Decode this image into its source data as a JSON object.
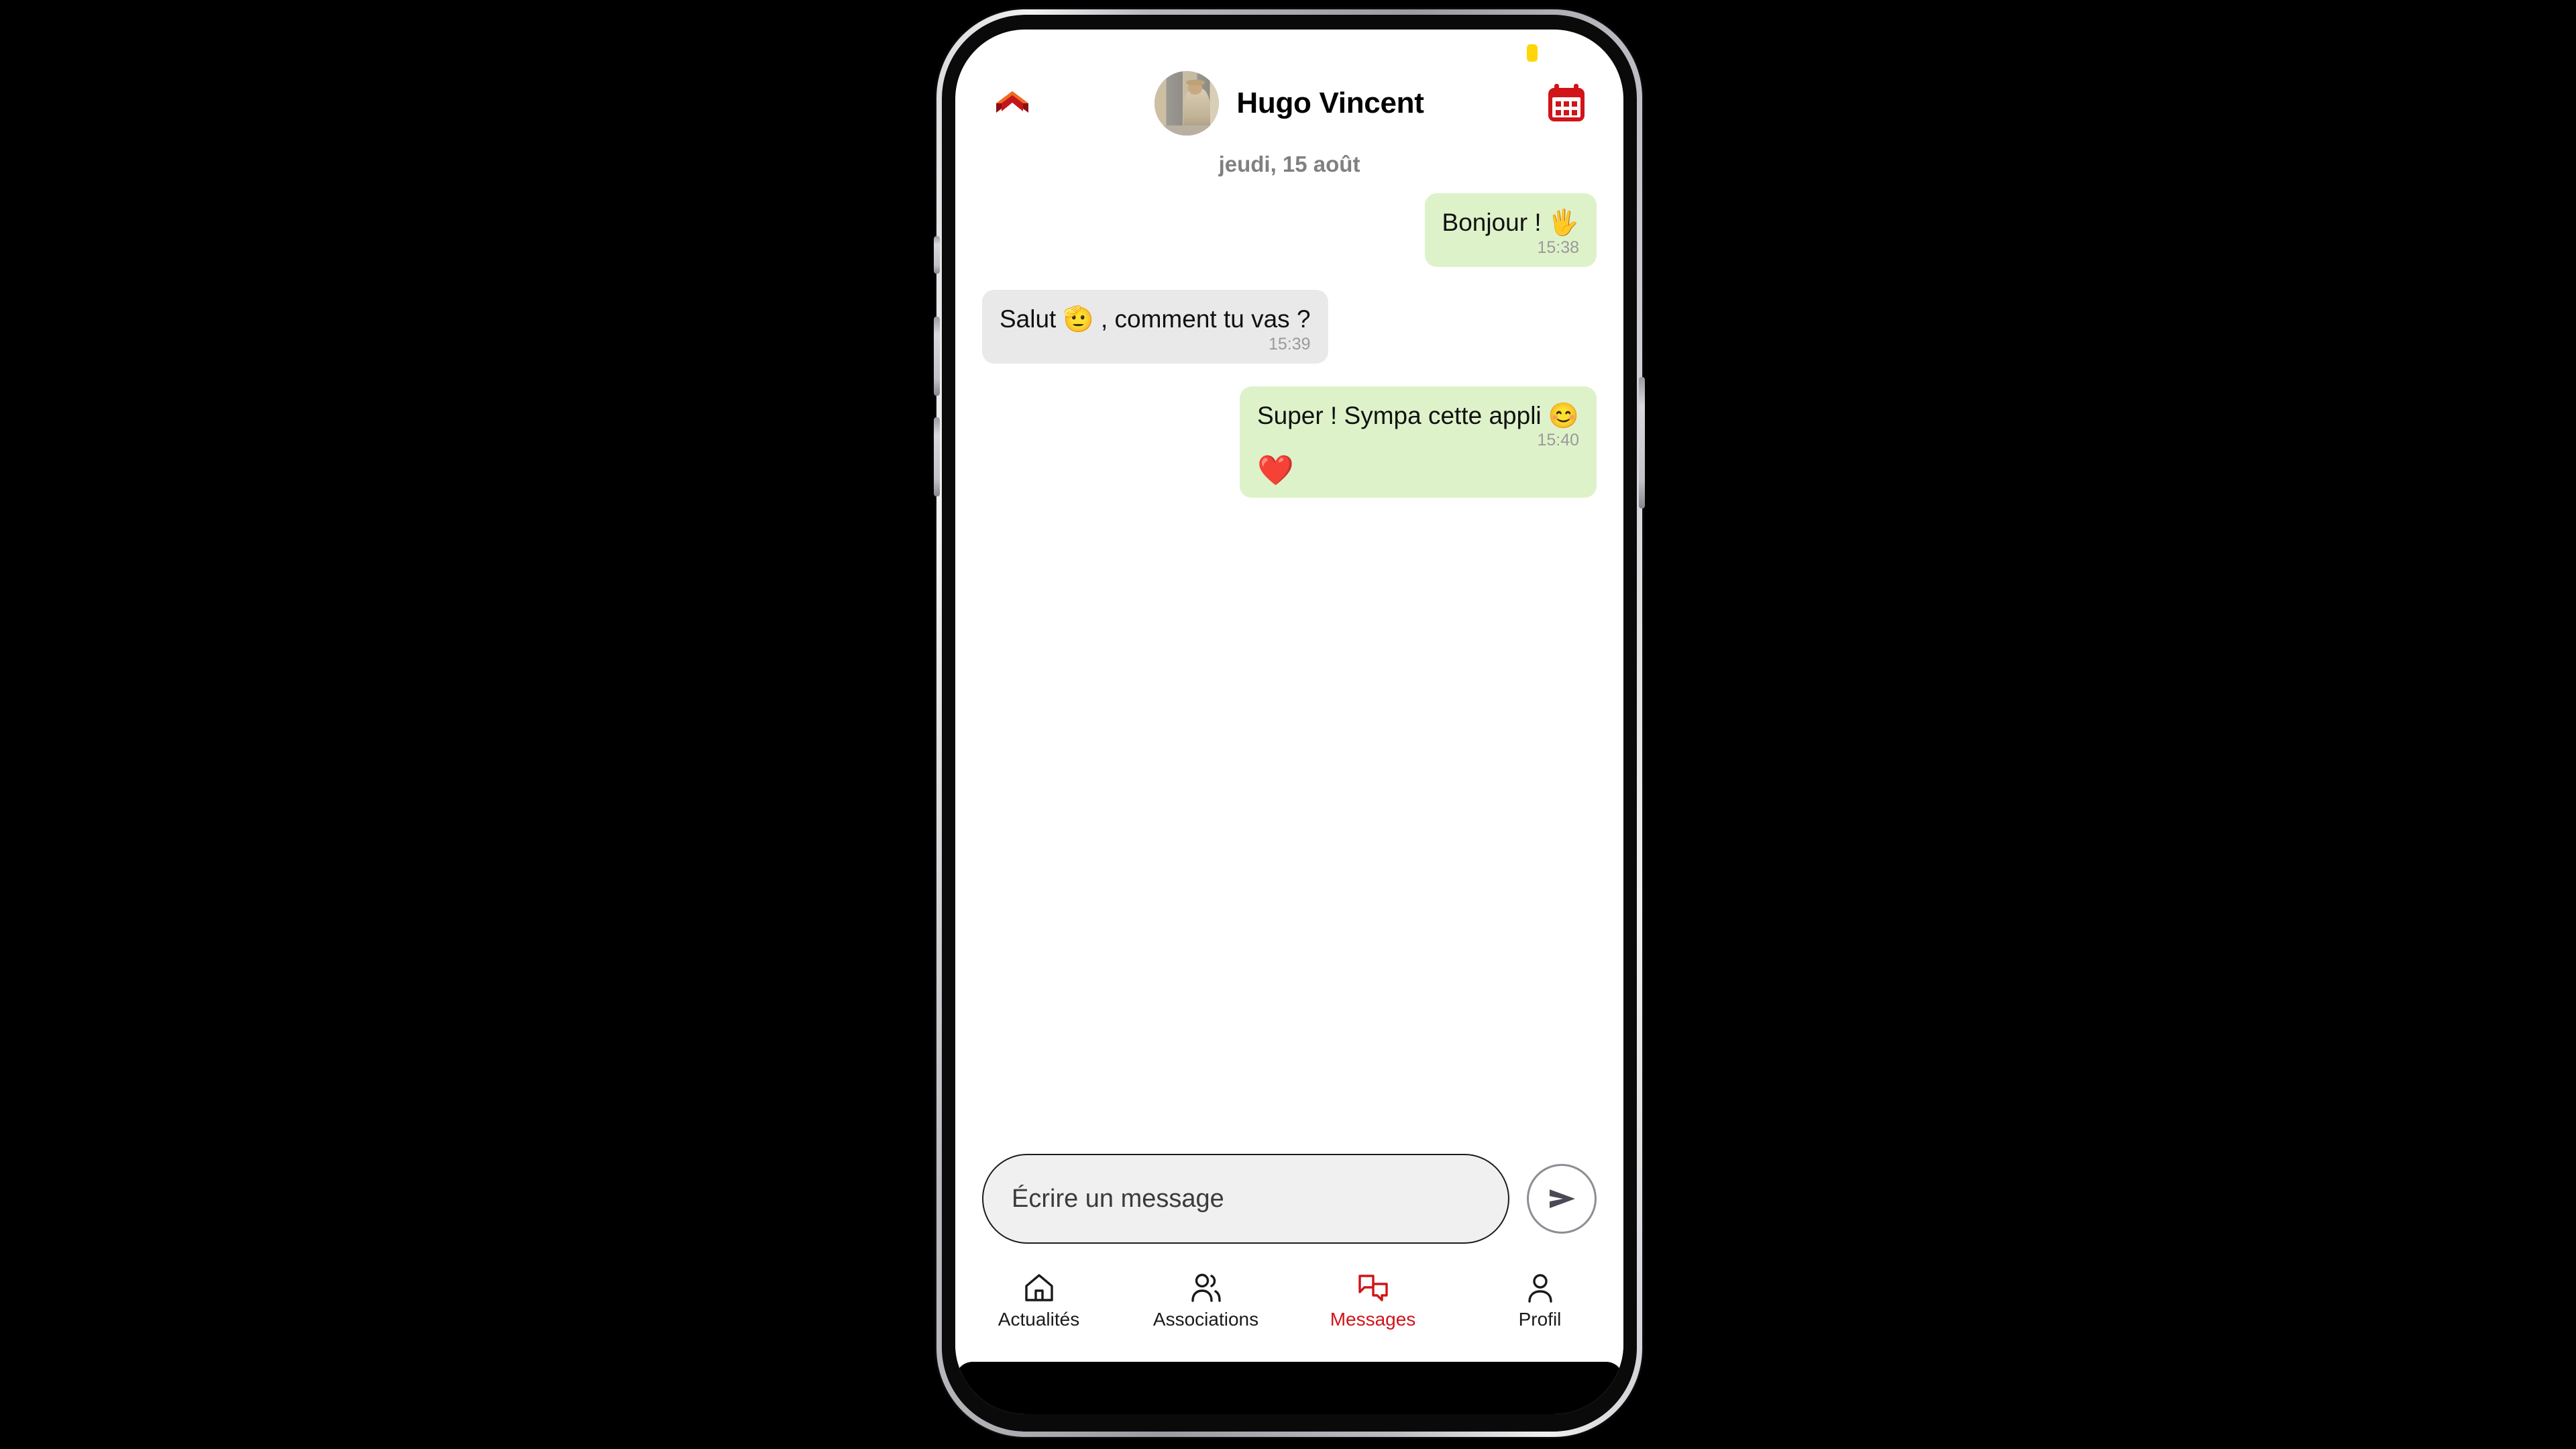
{
  "statusbar": {
    "badge_color": "#ffd60a",
    "badge_name": "status-indicator"
  },
  "header": {
    "back_icon": "back-chevron-logo-icon",
    "contact_name": "Hugo Vincent",
    "avatar_alt": "Hugo Vincent",
    "calendar_icon": "calendar-icon",
    "accent_color": "#d01418"
  },
  "conversation": {
    "date_separator": "jeudi, 15 août",
    "messages": [
      {
        "id": "msg-1",
        "direction": "out",
        "text": "Bonjour ! 🖐",
        "time": "15:38",
        "reaction": "",
        "bubble_color": "#ddf2c9"
      },
      {
        "id": "msg-2",
        "direction": "in",
        "text": "Salut 🫡 , comment tu vas ?",
        "time": "15:39",
        "reaction": "",
        "bubble_color": "#e9e9e9"
      },
      {
        "id": "msg-3",
        "direction": "out",
        "text": "Super ! Sympa cette appli 😊",
        "time": "15:40",
        "reaction": "❤️",
        "bubble_color": "#ddf2c9"
      }
    ]
  },
  "composer": {
    "placeholder": "Écrire un message",
    "value": "",
    "send_icon": "send-paper-plane-icon"
  },
  "bottom_nav": {
    "items": [
      {
        "id": "actualites",
        "label": "Actualités",
        "icon": "home-icon",
        "active": false
      },
      {
        "id": "associations",
        "label": "Associations",
        "icon": "people-icon",
        "active": false
      },
      {
        "id": "messages",
        "label": "Messages",
        "icon": "chat-bubbles-icon",
        "active": true
      },
      {
        "id": "profil",
        "label": "Profil",
        "icon": "person-icon",
        "active": false
      }
    ],
    "active_color": "#d01418",
    "inactive_color": "#1a1a1a"
  }
}
